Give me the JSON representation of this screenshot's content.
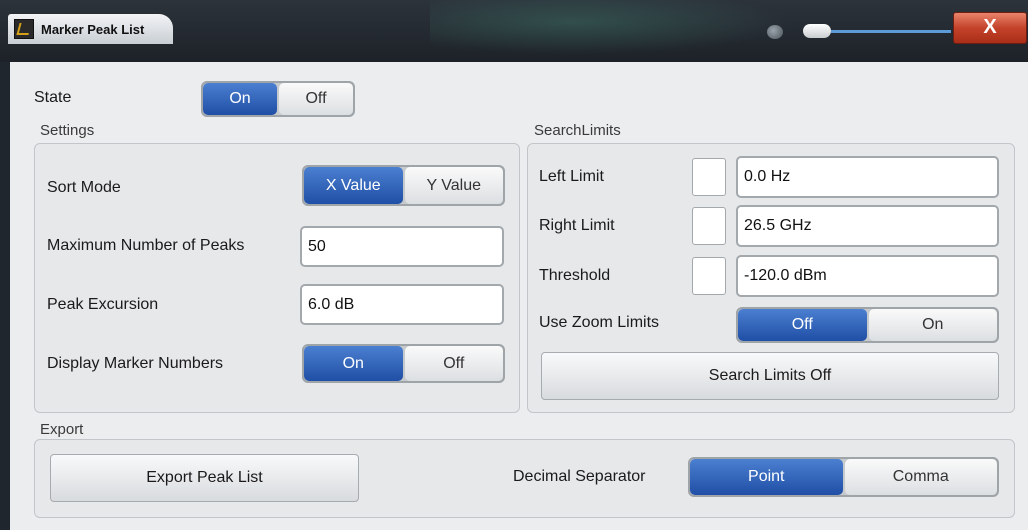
{
  "window": {
    "title": "Marker Peak List",
    "close_label": "X"
  },
  "state": {
    "label": "State",
    "options": [
      "On",
      "Off"
    ],
    "selected": "On"
  },
  "settings": {
    "title": "Settings",
    "sort_mode": {
      "label": "Sort Mode",
      "options": [
        "X Value",
        "Y Value"
      ],
      "selected": "X Value"
    },
    "max_peaks": {
      "label": "Maximum Number of Peaks",
      "value": "50"
    },
    "peak_excursion": {
      "label": "Peak Excursion",
      "value": "6.0 dB"
    },
    "display_marker_numbers": {
      "label": "Display Marker Numbers",
      "options": [
        "On",
        "Off"
      ],
      "selected": "On"
    }
  },
  "search_limits": {
    "title": "SearchLimits",
    "left_limit": {
      "label": "Left Limit",
      "value": "0.0 Hz"
    },
    "right_limit": {
      "label": "Right Limit",
      "value": "26.5 GHz"
    },
    "threshold": {
      "label": "Threshold",
      "value": "-120.0 dBm"
    },
    "use_zoom_limits": {
      "label": "Use Zoom Limits",
      "options": [
        "Off",
        "On"
      ],
      "selected": "Off"
    },
    "off_button": "Search Limits Off"
  },
  "export": {
    "title": "Export",
    "button": "Export Peak List",
    "decimal_separator": {
      "label": "Decimal Separator",
      "options": [
        "Point",
        "Comma"
      ],
      "selected": "Point"
    }
  },
  "colors": {
    "accent": "#1f4fa6",
    "close": "#c4422a",
    "background": "#ebedef"
  }
}
